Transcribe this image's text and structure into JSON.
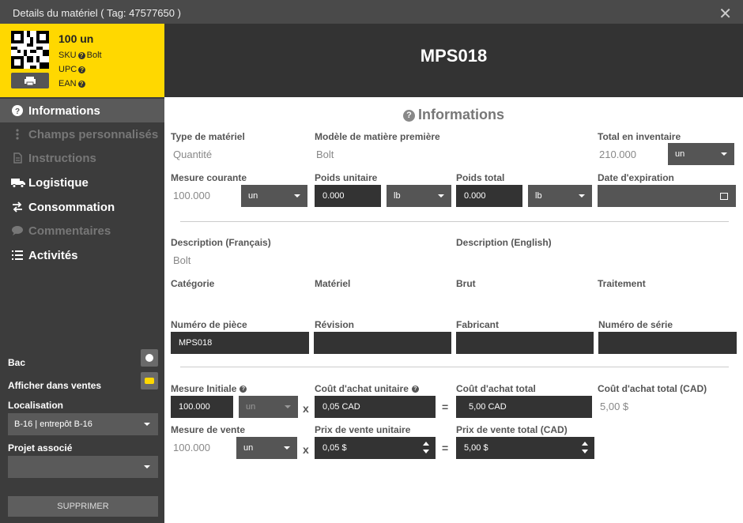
{
  "window": {
    "title": "Details du matériel ( Tag: 47577650 )",
    "close_glyph": "✕"
  },
  "tag_card": {
    "qty": "100 un",
    "sku_label": "SKU",
    "sku_value": "Bolt",
    "upc_label": "UPC",
    "ean_label": "EAN",
    "bg_color": "#ffd800"
  },
  "header": {
    "name": "MPS018"
  },
  "nav": [
    {
      "label": "Informations",
      "icon": "question-circle-icon"
    },
    {
      "label": "Champs personnalisés",
      "icon": "vertical-dots-icon"
    },
    {
      "label": "Instructions",
      "icon": "document-icon"
    },
    {
      "label": "Logistique",
      "icon": "truck-icon"
    },
    {
      "label": "Consommation",
      "icon": "exchange-arrows-icon"
    },
    {
      "label": "Commentaires",
      "icon": "speech-bubble-icon"
    },
    {
      "label": "Activités",
      "icon": "list-icon"
    }
  ],
  "sidebar": {
    "bac_label": "Bac",
    "ventes_label": "Afficher dans ventes",
    "localisation_label": "Localisation",
    "localisation_value": "B-16 | entrepôt B-16",
    "projet_label": "Projet associé",
    "projet_value": "",
    "delete_label": "SUPPRIMER"
  },
  "main": {
    "section_title": "Informations",
    "type_label": "Type de matériel",
    "type_value": "Quantité",
    "modele_label": "Modèle de matière première",
    "modele_value": "Bolt",
    "total_label": "Total en inventaire",
    "total_value": "210.000",
    "total_unit": "un",
    "mesure_label": "Mesure courante",
    "mesure_value": "100.000",
    "mesure_unit": "un",
    "poids_u_label": "Poids unitaire",
    "poids_u_value": "0.000",
    "poids_u_unit": "lb",
    "poids_t_label": "Poids total",
    "poids_t_value": "0.000",
    "poids_t_unit": "lb",
    "date_label": "Date d'expiration",
    "date_value": "",
    "desc_fr_label": "Description (Français)",
    "desc_fr_value": "Bolt",
    "desc_en_label": "Description (English)",
    "categorie_label": "Catégorie",
    "materiel_label": "Matériel",
    "brut_label": "Brut",
    "traitement_label": "Traitement",
    "piece_label": "Numéro de pièce",
    "piece_value": "MPS018",
    "revision_label": "Révision",
    "revision_value": "",
    "fabricant_label": "Fabricant",
    "fabricant_value": "",
    "serie_label": "Numéro de série",
    "serie_value": "",
    "mesure_init_label": "Mesure Initiale",
    "mesure_init_value": "100.000",
    "mesure_init_unit": "un",
    "cout_u_label": "Coût d'achat unitaire",
    "cout_u_value": "0,05 CAD",
    "cout_t_label": "Coût d'achat total",
    "cout_t_value": "5,00 CAD",
    "cout_cad_label": "Coût d'achat total (CAD)",
    "cout_cad_value": "5,00 $",
    "vente_label": "Mesure de vente",
    "vente_value": "100.000",
    "vente_unit": "un",
    "prix_u_label": "Prix de vente unitaire",
    "prix_u_value": "0,05 $",
    "prix_t_label": "Prix de vente total (CAD)",
    "prix_t_value": "5,00 $",
    "op_times": "x",
    "op_equals": "="
  }
}
